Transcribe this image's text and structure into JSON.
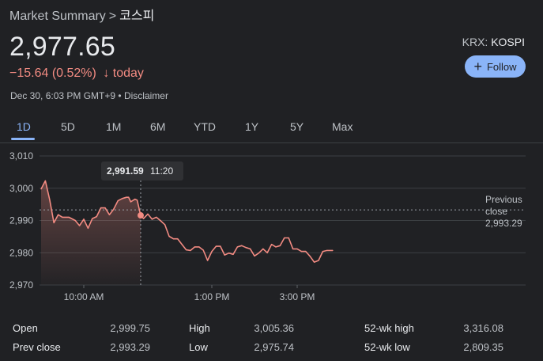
{
  "breadcrumb": {
    "root": "Market Summary",
    "separator": ">",
    "current": "코스피"
  },
  "quote": {
    "price": "2,977.65",
    "change": "−15.64 (0.52%)",
    "change_arrow": "↓",
    "change_period": "today",
    "timestamp": "Dec 30, 6:03 PM GMT+9",
    "disclaimer": "Disclaimer",
    "exchange": "KRX",
    "symbol": "KOSPI"
  },
  "follow_button": {
    "icon": "plus-icon",
    "label": "Follow"
  },
  "tabs": [
    {
      "label": "1D",
      "active": true
    },
    {
      "label": "5D"
    },
    {
      "label": "1M"
    },
    {
      "label": "6M"
    },
    {
      "label": "YTD"
    },
    {
      "label": "1Y"
    },
    {
      "label": "5Y"
    },
    {
      "label": "Max"
    }
  ],
  "chart_data": {
    "type": "line",
    "ylim": [
      2970,
      3010
    ],
    "yticks": [
      "3,010",
      "3,000",
      "2,990",
      "2,980",
      "2,970"
    ],
    "xticks": [
      "10:00 AM",
      "1:00 PM",
      "3:00 PM"
    ],
    "line_color": "#f28b82",
    "tooltip": {
      "value": "2,991.59",
      "time": "11:20"
    },
    "previous_close": {
      "label_line1": "Previous",
      "label_line2": "close",
      "value": "2,993.29"
    },
    "series": [
      {
        "x": "09:00",
        "y": 2999.75
      },
      {
        "x": "09:06",
        "y": 3002.3
      },
      {
        "x": "09:12",
        "y": 2996.5
      },
      {
        "x": "09:18",
        "y": 2989.3
      },
      {
        "x": "09:24",
        "y": 2991.8
      },
      {
        "x": "09:30",
        "y": 2991.0
      },
      {
        "x": "09:39",
        "y": 2991.0
      },
      {
        "x": "09:48",
        "y": 2990.0
      },
      {
        "x": "09:54",
        "y": 2988.4
      },
      {
        "x": "10:00",
        "y": 2990.4
      },
      {
        "x": "10:06",
        "y": 2987.6
      },
      {
        "x": "10:12",
        "y": 2990.6
      },
      {
        "x": "10:18",
        "y": 2991.2
      },
      {
        "x": "10:24",
        "y": 2993.9
      },
      {
        "x": "10:30",
        "y": 2993.9
      },
      {
        "x": "10:36",
        "y": 2991.8
      },
      {
        "x": "10:42",
        "y": 2993.5
      },
      {
        "x": "10:48",
        "y": 2996.1
      },
      {
        "x": "10:54",
        "y": 2996.8
      },
      {
        "x": "11:00",
        "y": 2997.2
      },
      {
        "x": "11:03",
        "y": 2997.2
      },
      {
        "x": "11:06",
        "y": 2995.8
      },
      {
        "x": "11:12",
        "y": 2996.6
      },
      {
        "x": "11:15",
        "y": 2996.3
      },
      {
        "x": "11:20",
        "y": 2991.59
      },
      {
        "x": "11:24",
        "y": 2990.6
      },
      {
        "x": "11:30",
        "y": 2992.0
      },
      {
        "x": "11:36",
        "y": 2990.4
      },
      {
        "x": "11:42",
        "y": 2991.0
      },
      {
        "x": "11:48",
        "y": 2989.9
      },
      {
        "x": "11:54",
        "y": 2988.7
      },
      {
        "x": "12:00",
        "y": 2985.1
      },
      {
        "x": "12:06",
        "y": 2984.3
      },
      {
        "x": "12:12",
        "y": 2984.3
      },
      {
        "x": "12:18",
        "y": 2982.6
      },
      {
        "x": "12:24",
        "y": 2980.9
      },
      {
        "x": "12:30",
        "y": 2980.7
      },
      {
        "x": "12:36",
        "y": 2981.8
      },
      {
        "x": "12:42",
        "y": 2981.8
      },
      {
        "x": "12:48",
        "y": 2980.8
      },
      {
        "x": "12:54",
        "y": 2977.6
      },
      {
        "x": "13:00",
        "y": 2980.4
      },
      {
        "x": "13:06",
        "y": 2982.0
      },
      {
        "x": "13:12",
        "y": 2982.0
      },
      {
        "x": "13:18",
        "y": 2979.3
      },
      {
        "x": "13:24",
        "y": 2979.9
      },
      {
        "x": "13:30",
        "y": 2979.5
      },
      {
        "x": "13:36",
        "y": 2981.8
      },
      {
        "x": "13:42",
        "y": 2982.2
      },
      {
        "x": "13:48",
        "y": 2981.6
      },
      {
        "x": "13:54",
        "y": 2981.2
      },
      {
        "x": "14:00",
        "y": 2979.0
      },
      {
        "x": "14:06",
        "y": 2979.9
      },
      {
        "x": "14:12",
        "y": 2981.2
      },
      {
        "x": "14:18",
        "y": 2980.0
      },
      {
        "x": "14:24",
        "y": 2982.6
      },
      {
        "x": "14:30",
        "y": 2981.8
      },
      {
        "x": "14:36",
        "y": 2982.2
      },
      {
        "x": "14:42",
        "y": 2984.6
      },
      {
        "x": "14:48",
        "y": 2984.6
      },
      {
        "x": "14:54",
        "y": 2981.2
      },
      {
        "x": "15:00",
        "y": 2981.2
      },
      {
        "x": "15:06",
        "y": 2980.4
      },
      {
        "x": "15:12",
        "y": 2980.4
      },
      {
        "x": "15:18",
        "y": 2978.9
      },
      {
        "x": "15:24",
        "y": 2977.1
      },
      {
        "x": "15:30",
        "y": 2977.6
      },
      {
        "x": "15:36",
        "y": 2980.4
      },
      {
        "x": "15:42",
        "y": 2980.7
      },
      {
        "x": "15:50",
        "y": 2980.7
      }
    ]
  },
  "stats": [
    {
      "label": "Open",
      "value": "2,999.75"
    },
    {
      "label": "High",
      "value": "3,005.36"
    },
    {
      "label": "52-wk high",
      "value": "3,316.08"
    },
    {
      "label": "Prev close",
      "value": "2,993.29"
    },
    {
      "label": "Low",
      "value": "2,975.74"
    },
    {
      "label": "52-wk low",
      "value": "2,809.35"
    }
  ]
}
